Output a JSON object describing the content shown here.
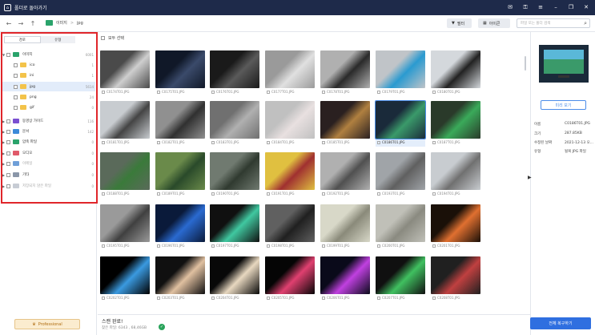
{
  "titlebar": {
    "title": "폴더로 돌아가기"
  },
  "nav": {
    "crumb_root": "이미지",
    "crumb_sep": ">",
    "crumb_leaf": "jpg"
  },
  "toolbar": {
    "filter_label": "필터",
    "view_label": "아이콘",
    "search_placeholder": "파일 또는 폴더 검색"
  },
  "sidebar": {
    "tabs": [
      "경로",
      "유형"
    ],
    "items": [
      {
        "label": "이미지",
        "count": "6001",
        "level": 0,
        "icon": "image-folder-icon",
        "color": "#2aa36b",
        "expanded": true
      },
      {
        "label": "ico",
        "count": "1",
        "level": 1,
        "icon": "folder-icon",
        "color": "#f3c34a"
      },
      {
        "label": "ini",
        "count": "1",
        "level": 1,
        "icon": "folder-icon",
        "color": "#f3c34a"
      },
      {
        "label": "jpg",
        "count": "5614",
        "level": 1,
        "icon": "folder-icon",
        "color": "#f3c34a",
        "selected": true
      },
      {
        "label": "png",
        "count": "24",
        "level": 1,
        "icon": "folder-icon",
        "color": "#f3c34a"
      },
      {
        "label": "gif",
        "count": "0",
        "level": 1,
        "icon": "folder-icon",
        "color": "#f3c34a"
      },
      {
        "label": "동영상 가이드",
        "count": "116",
        "level": 0,
        "icon": "video-folder-icon",
        "color": "#7a4fd1"
      },
      {
        "label": "문서",
        "count": "142",
        "level": 0,
        "icon": "document-folder-icon",
        "color": "#3b8ad9"
      },
      {
        "label": "압축 파일",
        "count": "0",
        "level": 0,
        "icon": "archive-folder-icon",
        "color": "#2aa36b"
      },
      {
        "label": "오디오",
        "count": "0",
        "level": 0,
        "icon": "audio-folder-icon",
        "color": "#e05a6a"
      },
      {
        "label": "이메일",
        "count": "0",
        "level": 0,
        "icon": "email-folder-icon",
        "color": "#6f9fd8",
        "dim": true
      },
      {
        "label": "기타",
        "count": "0",
        "level": 0,
        "icon": "other-folder-icon",
        "color": "#8a96a8"
      },
      {
        "label": "저장되지 않은 파일",
        "count": "0",
        "level": 0,
        "icon": "unsaved-folder-icon",
        "color": "#c7ccd4",
        "dim": true
      }
    ],
    "pro_label": "Professional"
  },
  "content": {
    "select_all": "모두 선택",
    "files": [
      "C0174T01.JPG",
      "C0175T01.JPG",
      "C0176T01.JPG",
      "C0177T01.JPG",
      "C0178T01.JPG",
      "C0179T01.JPG",
      "C0180T01.JPG",
      "C0181T01.JPG",
      "C0182T01.JPG",
      "C0183T01.JPG",
      "C0184T01.JPG",
      "C0185T01.JPG",
      "C0186T01.JPG",
      "C0187T01.JPG",
      "C0188T01.JPG",
      "C0189T01.JPG",
      "C0190T01.JPG",
      "C0191T01.JPG",
      "C0192T01.JPG",
      "C0193T01.JPG",
      "C0194T01.JPG",
      "C0195T01.JPG",
      "C0196T01.JPG",
      "C0197T01.JPG",
      "C0198T01.JPG",
      "C0199T01.JPG",
      "C0200T01.JPG",
      "C0201T01.JPG",
      "C0202T01.JPG",
      "C0203T01.JPG",
      "C0204T01.JPG",
      "C0205T01.JPG",
      "C0206T01.JPG",
      "C0207T01.JPG",
      "C0208T01.JPG"
    ],
    "thumb_colors": [
      [
        "#4a4a4a",
        "#cfcfcf"
      ],
      [
        "#101828",
        "#3a4a6a"
      ],
      [
        "#1a1a1a",
        "#5a5a5a"
      ],
      [
        "#9a9a9a",
        "#e0e0e0"
      ],
      [
        "#b0b0b0",
        "#2a2a2a"
      ],
      [
        "#c0c4c8",
        "#2a9ad0"
      ],
      [
        "#d4d8dc",
        "#222"
      ],
      [
        "#c8ccd0",
        "#444"
      ],
      [
        "#909090",
        "#303030"
      ],
      [
        "#707070",
        "#b0b0b0"
      ],
      [
        "#c0c0c0",
        "#e8e0e0"
      ],
      [
        "#2a2020",
        "#b08040"
      ],
      [
        "#1a2a3a",
        "#3a9a6a"
      ],
      [
        "#2a3a2a",
        "#3aaa5a"
      ],
      [
        "#5a6a5a",
        "#3a7a3a"
      ],
      [
        "#6a8a4a",
        "#2a4a2a"
      ],
      [
        "#707a70",
        "#303a30"
      ],
      [
        "#e0c040",
        "#a03030"
      ],
      [
        "#b0b0b0",
        "#505050"
      ],
      [
        "#a0a4a8",
        "#606060"
      ],
      [
        "#c8ccd0",
        "#707070"
      ],
      [
        "#9a9a9a",
        "#404040"
      ],
      [
        "#0a1a3a",
        "#2a6ad0"
      ],
      [
        "#101010",
        "#40c8a0"
      ],
      [
        "#606060",
        "#202020"
      ],
      [
        "#d8d8c8",
        "#8a8a7a"
      ],
      [
        "#c0c0b8",
        "#8a8a80"
      ],
      [
        "#1a1008",
        "#e07030"
      ],
      [
        "#000",
        "#3a9ae0"
      ],
      [
        "#101010",
        "#e0c0a0"
      ],
      [
        "#080808",
        "#e8d8c0"
      ],
      [
        "#050505",
        "#e04070"
      ],
      [
        "#0a0a1a",
        "#c040e0"
      ],
      [
        "#101010",
        "#40c060"
      ],
      [
        "#202020",
        "#c04040"
      ]
    ]
  },
  "rightpanel": {
    "preview_button": "미리 보기",
    "info": [
      {
        "label": "이름",
        "value": "C0186T01.JPG"
      },
      {
        "label": "크기",
        "value": "287.85KB"
      },
      {
        "label": "수정된 날짜",
        "value": "2021-12-13 오..."
      },
      {
        "label": "유형",
        "value": "될복 JPG 파일"
      }
    ]
  },
  "status": {
    "title": "스캔 완료!",
    "detail": "찾은 파일: 6343 , 68,46GB",
    "recover_label": "전체 복구하기"
  }
}
